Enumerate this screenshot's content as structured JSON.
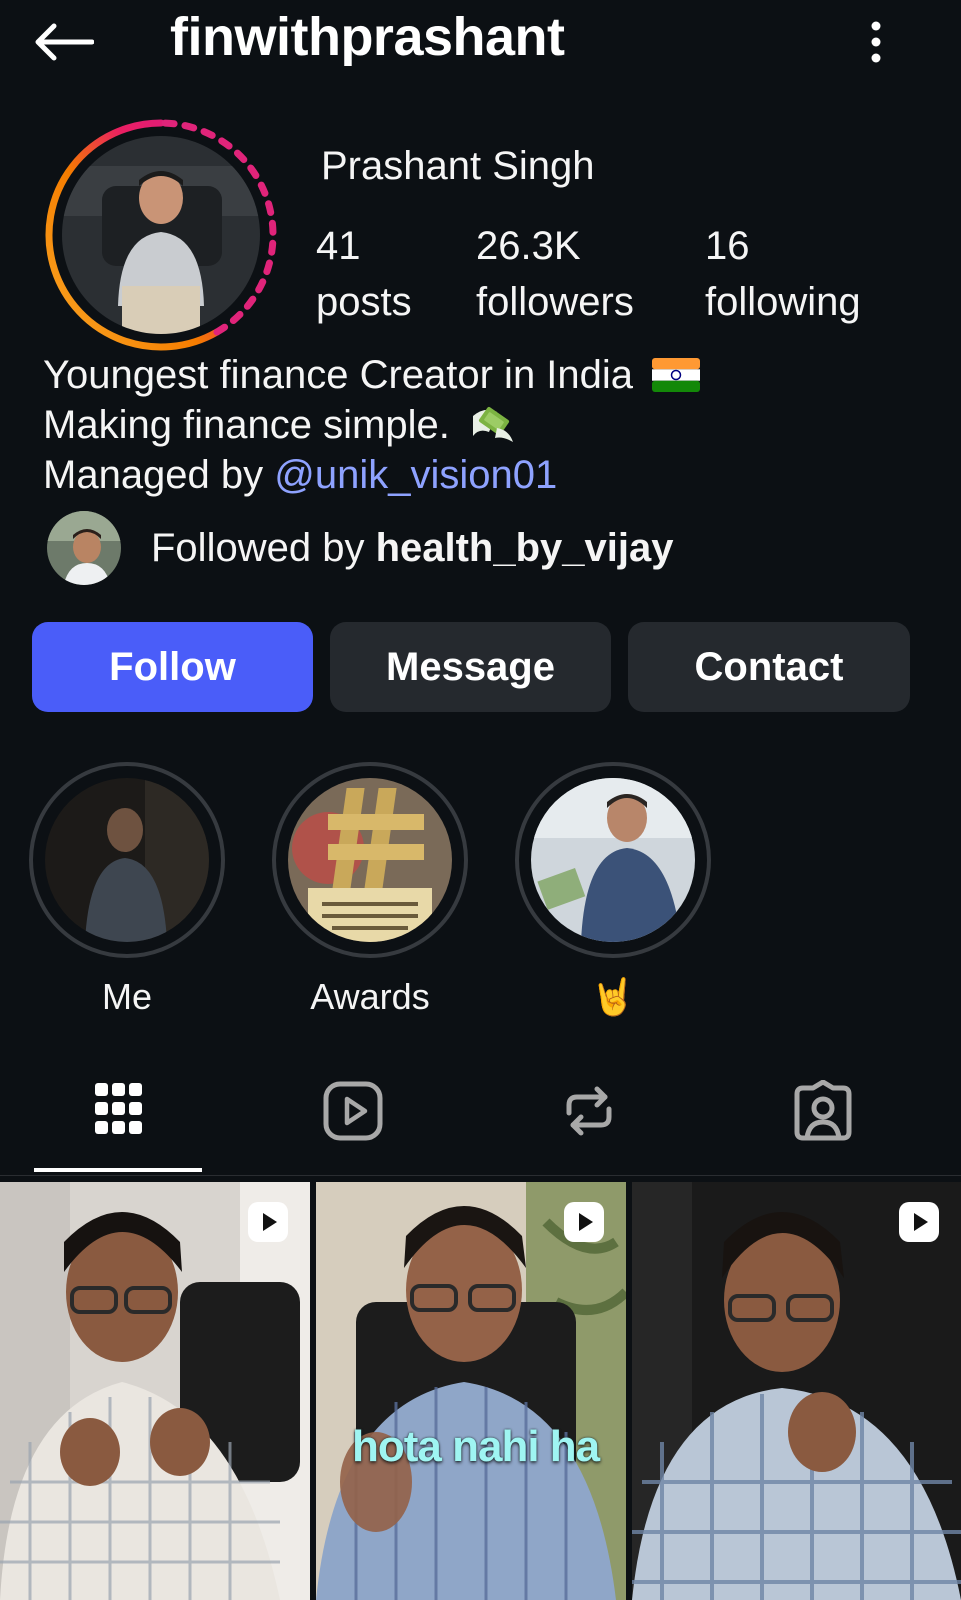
{
  "header": {
    "username": "finwithprashant",
    "back_icon": "arrow-left-icon",
    "more_icon": "kebab-menu-icon"
  },
  "profile": {
    "display_name": "Prashant Singh",
    "stats": [
      {
        "value": "41",
        "label": "posts"
      },
      {
        "value": "26.3K",
        "label": "followers"
      },
      {
        "value": "16",
        "label": "following"
      }
    ],
    "bio": {
      "line1": "Youngest finance Creator in India",
      "line2": "Making finance simple.",
      "line3_prefix": "Managed by",
      "mention": "@unik_vision01"
    },
    "followed_by": {
      "prefix": "Followed by",
      "name": "health_by_vijay"
    }
  },
  "actions": {
    "follow": "Follow",
    "message": "Message",
    "contact": "Contact"
  },
  "highlights": [
    {
      "label": "Me"
    },
    {
      "label": "Awards"
    },
    {
      "label": "🤘"
    }
  ],
  "tabs": [
    {
      "icon": "grid-icon",
      "active": true
    },
    {
      "icon": "reels-icon",
      "active": false
    },
    {
      "icon": "reposts-icon",
      "active": false
    },
    {
      "icon": "tagged-icon",
      "active": false
    }
  ],
  "posts": [
    {
      "type": "reel",
      "caption": ""
    },
    {
      "type": "reel",
      "caption": "hota nahi ha"
    },
    {
      "type": "reel",
      "caption": ""
    }
  ],
  "colors": {
    "background": "#0c1014",
    "follow_button": "#4a5df9",
    "secondary_button": "#25292e",
    "mention": "#8ea2ff"
  }
}
